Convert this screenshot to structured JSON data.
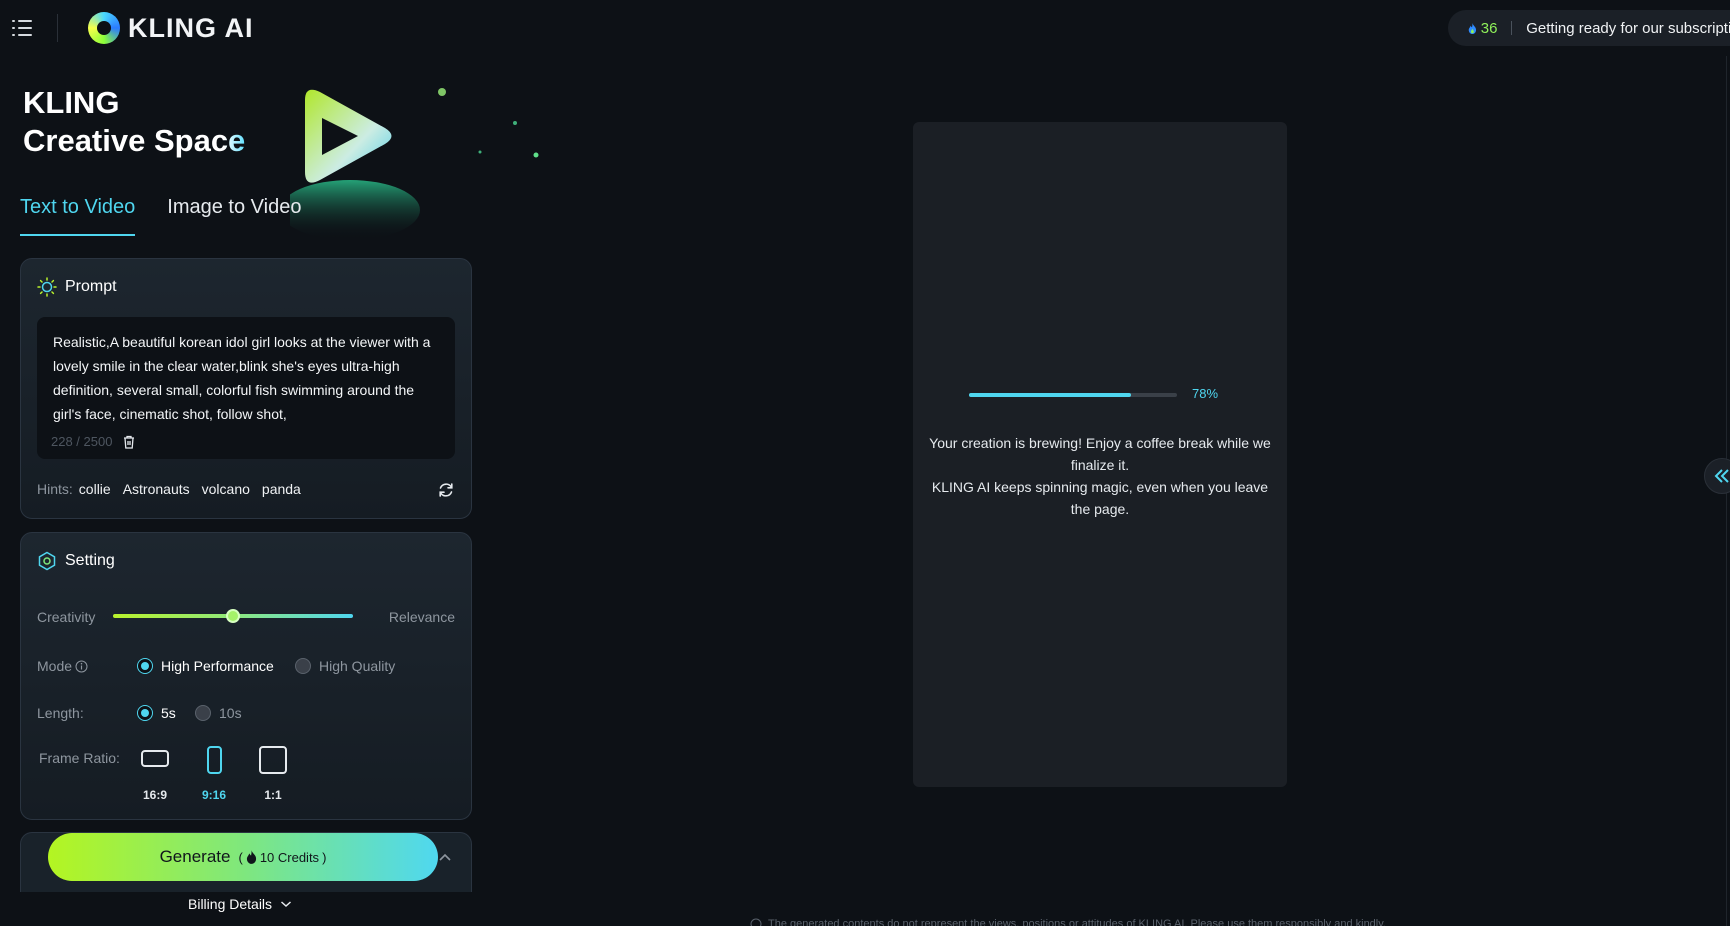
{
  "header": {
    "brand": "KLING AI",
    "credits": "36",
    "announcement": "Getting ready for our subscription"
  },
  "hero": {
    "line1": "KLING",
    "line2_start": "Creative Sp",
    "line2_accent": "ace"
  },
  "tabs": [
    {
      "label": "Text to Video",
      "active": true
    },
    {
      "label": "Image to Video",
      "active": false
    }
  ],
  "prompt": {
    "title": "Prompt",
    "text": "Realistic,A beautiful korean idol girl looks at the viewer with a lovely smile in the clear water,blink she's eyes ultra-high definition, several small, colorful fish swimming around the girl's face, cinematic shot, follow shot,",
    "counter": "228 / 2500",
    "hints_label": "Hints:",
    "hints": [
      "collie",
      "Astronauts",
      "volcano",
      "panda"
    ]
  },
  "setting": {
    "title": "Setting",
    "creativity_label": "Creativity",
    "relevance_label": "Relevance",
    "slider_value": 0.5,
    "mode_label": "Mode",
    "modes": [
      {
        "label": "High Performance",
        "selected": true
      },
      {
        "label": "High Quality",
        "selected": false
      }
    ],
    "length_label": "Length:",
    "lengths": [
      {
        "label": "5s",
        "selected": true
      },
      {
        "label": "10s",
        "selected": false
      }
    ],
    "ratio_label": "Frame Ratio:",
    "ratios": [
      {
        "label": "16:9",
        "selected": false
      },
      {
        "label": "9:16",
        "selected": true
      },
      {
        "label": "1:1",
        "selected": false
      }
    ]
  },
  "generate": {
    "label": "Generate",
    "credits_text": "10 Credits",
    "open_paren": "(",
    "close_paren": ")",
    "billing_label": "Billing Details"
  },
  "preview": {
    "progress": 78,
    "progress_text": "78%",
    "message_line1": "Your creation is brewing! Enjoy a coffee break while we finalize it.",
    "message_line2": "KLING AI keeps spinning magic, even when you leave the page."
  },
  "footer": {
    "disclaimer": "The generated contents do not represent the views, positions or attitudes of KLING AI. Please use them responsibly and kindly."
  },
  "colors": {
    "accent": "#4fd6ef",
    "lime": "#b4f521",
    "background": "#0d1116",
    "credits_green": "#8ff05a"
  }
}
